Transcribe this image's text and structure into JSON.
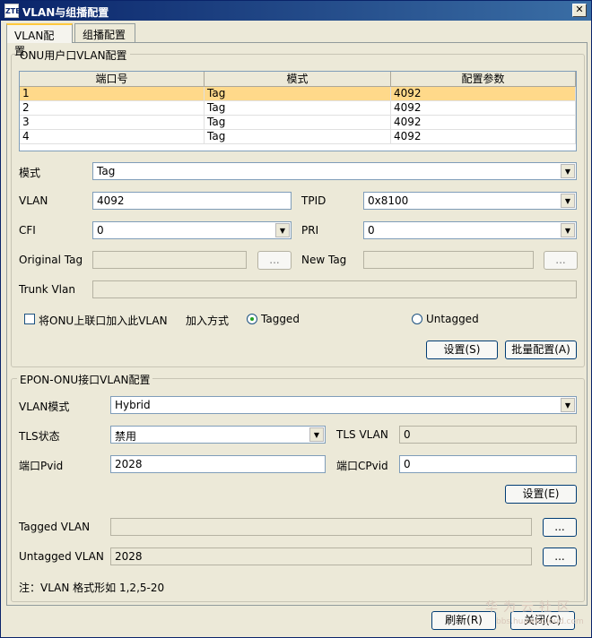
{
  "window": {
    "title": "VLAN与组播配置",
    "icon_text": "ZTE",
    "close_glyph": "✕"
  },
  "tabs": [
    {
      "label": "VLAN配置",
      "active": true
    },
    {
      "label": "组播配置",
      "active": false
    }
  ],
  "onu_group": {
    "title": "ONU用户口VLAN配置",
    "table": {
      "headers": [
        "端口号",
        "模式",
        "配置参数"
      ],
      "rows": [
        {
          "port": "1",
          "mode": "Tag",
          "param": "4092",
          "selected": true
        },
        {
          "port": "2",
          "mode": "Tag",
          "param": "4092",
          "selected": false
        },
        {
          "port": "3",
          "mode": "Tag",
          "param": "4092",
          "selected": false
        },
        {
          "port": "4",
          "mode": "Tag",
          "param": "4092",
          "selected": false
        }
      ]
    },
    "mode_label": "模式",
    "mode_value": "Tag",
    "vlan_label": "VLAN",
    "vlan_value": "4092",
    "tpid_label": "TPID",
    "tpid_value": "0x8100",
    "cfi_label": "CFI",
    "cfi_value": "0",
    "pri_label": "PRI",
    "pri_value": "0",
    "original_tag_label": "Original Tag",
    "original_tag_value": "",
    "new_tag_label": "New Tag",
    "new_tag_value": "",
    "trunk_vlan_label": "Trunk Vlan",
    "trunk_vlan_value": "",
    "browse_label": "...",
    "uplink_checkbox_label": "将ONU上联口加入此VLAN",
    "join_mode_label": "加入方式",
    "tagged_label": "Tagged",
    "untagged_label": "Untagged",
    "set_button": "设置(S)",
    "batch_button": "批量配置(A)"
  },
  "epon_group": {
    "title": "EPON-ONU接口VLAN配置",
    "vlan_mode_label": "VLAN模式",
    "vlan_mode_value": "Hybrid",
    "tls_status_label": "TLS状态",
    "tls_status_value": "禁用",
    "tls_vlan_label": "TLS VLAN",
    "tls_vlan_value": "0",
    "pvid_label": "端口Pvid",
    "pvid_value": "2028",
    "cpvid_label": "端口CPvid",
    "cpvid_value": "0",
    "set_button": "设置(E)",
    "tagged_vlan_label": "Tagged VLAN",
    "tagged_vlan_value": "",
    "untagged_vlan_label": "Untagged VLAN",
    "untagged_vlan_value": "2028",
    "browse_label": "..."
  },
  "note": "注：VLAN 格式形如 1,2,5-20",
  "footer": {
    "refresh_button": "刷新(R)",
    "close_button": "关闭(C)"
  },
  "watermark": {
    "text": "华为云社区",
    "url": "bbs.huaweicloud.com"
  }
}
